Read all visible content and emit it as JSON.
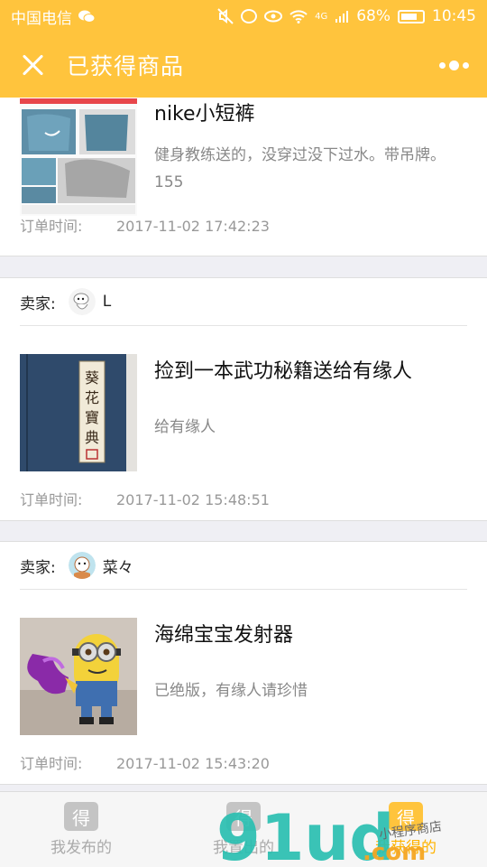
{
  "status": {
    "carrier": "中国电信",
    "network": "4G",
    "battery": "68%",
    "time": "10:45"
  },
  "header": {
    "title": "已获得商品"
  },
  "seller_label": "卖家:",
  "order_time_label": "订单时间:",
  "orders": [
    {
      "seller": "",
      "title": "nike小短裤",
      "desc": "健身教练送的，没穿过没下过水。带吊牌。155",
      "time": "2017-11-02 17:42:23"
    },
    {
      "seller": "L",
      "title": "捡到一本武功秘籍送给有缘人",
      "desc": "给有缘人",
      "time": "2017-11-02 15:48:51"
    },
    {
      "seller": "菜々",
      "title": "海绵宝宝发射器",
      "desc": "已绝版，有缘人请珍惜",
      "time": "2017-11-02 15:43:20"
    }
  ],
  "tabs": [
    {
      "label": "我发布的",
      "icon": "得"
    },
    {
      "label": "我置出的",
      "icon": "得"
    },
    {
      "label": "我获得的",
      "icon": "得"
    }
  ],
  "watermark": {
    "brand": "91ud",
    "suffix": ".com",
    "sub": "小程序商店"
  },
  "colors": {
    "accent": "#ffc43d",
    "watermark_teal": "#2bbfb1",
    "watermark_orange": "#f5a623"
  }
}
